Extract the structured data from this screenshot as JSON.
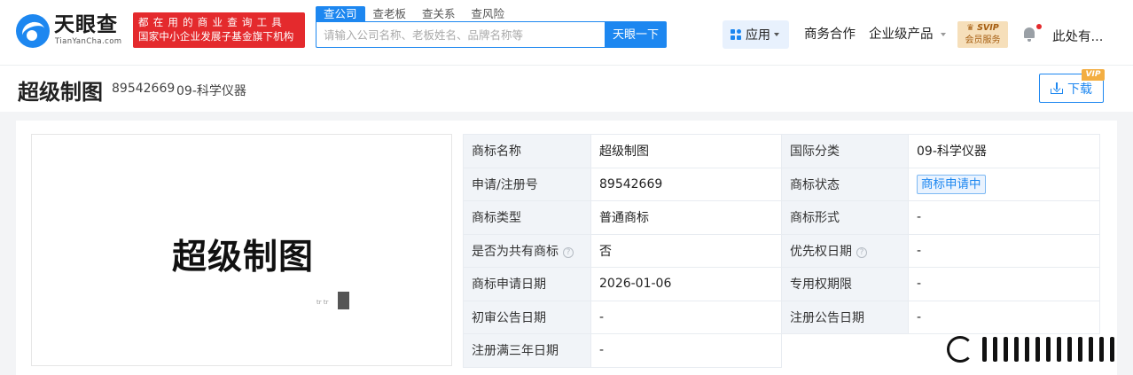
{
  "header": {
    "logo": {
      "cn": "天眼查",
      "en": "TianYanCha.com"
    },
    "slogan": {
      "line1": "都在用的商业查询工具",
      "line2": "国家中小企业发展子基金旗下机构"
    },
    "search": {
      "tabs": [
        "查公司",
        "查老板",
        "查关系",
        "查风险"
      ],
      "placeholder": "请输入公司名称、老板姓名、品牌名称等",
      "button": "天眼一下"
    },
    "nav": {
      "app": "应用",
      "business": "商务合作",
      "enterprise": "企业级产品",
      "svip_title": "SVIP",
      "svip_sub": "会员服务",
      "user": "此处有..."
    }
  },
  "title_bar": {
    "title": "超级制图",
    "reg_no": "89542669",
    "class": "09-科学仪器",
    "download": "下载",
    "vip": "VIP"
  },
  "trademark_image": {
    "text": "超级制图",
    "dots": "tr tr"
  },
  "info": {
    "rows": [
      [
        {
          "label": "商标名称",
          "value": "超级制图"
        },
        {
          "label": "国际分类",
          "value": "09-科学仪器"
        }
      ],
      [
        {
          "label": "申请/注册号",
          "value": "89542669"
        },
        {
          "label": "商标状态",
          "value": "商标申请中"
        }
      ],
      [
        {
          "label": "商标类型",
          "value": "普通商标"
        },
        {
          "label": "商标形式",
          "value": "-"
        }
      ],
      [
        {
          "label": "是否为共有商标",
          "value": "否"
        },
        {
          "label": "优先权日期",
          "value": "-"
        }
      ],
      [
        {
          "label": "商标申请日期",
          "value": "2026-01-06"
        },
        {
          "label": "专用权期限",
          "value": "-"
        }
      ],
      [
        {
          "label": "初审公告日期",
          "value": "-"
        },
        {
          "label": "注册公告日期",
          "value": "-"
        }
      ],
      [
        {
          "label": "注册满三年日期",
          "value": "-"
        }
      ]
    ],
    "help_symbol": "?"
  },
  "colors": {
    "brand": "#1d87f0",
    "slogan_bg": "#e42a2d",
    "svip_bg": "#f6dfba",
    "vip_tag": "#f3ae42"
  }
}
